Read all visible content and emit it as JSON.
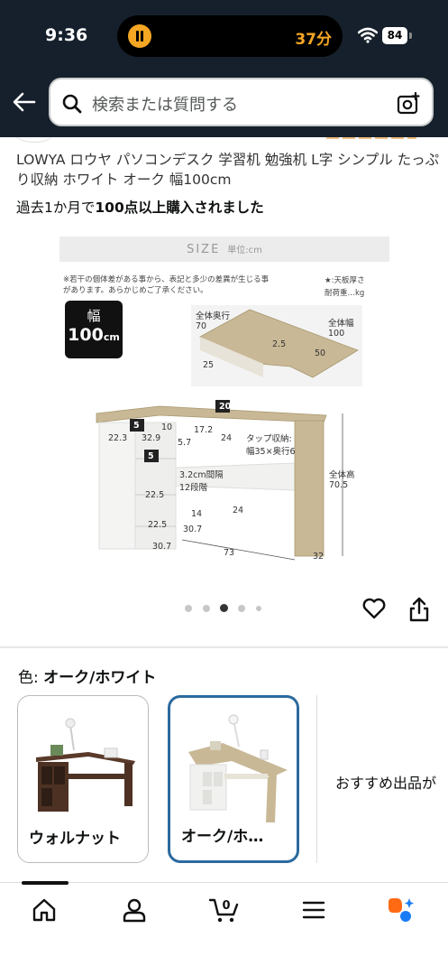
{
  "status_bar": {
    "time": "9:36",
    "timer_text": "37分",
    "battery": "84"
  },
  "header": {
    "search_placeholder": "検索または質問する",
    "icons": [
      "back-arrow-icon",
      "search-icon",
      "camera-icon"
    ]
  },
  "product": {
    "title": "LOWYA ロウヤ パソコンデスク 学習机 勉強机 L字 シンプル たっぷり収納 ホワイト オーク 幅100cm",
    "purchase_prefix": "過去1か月で",
    "purchase_bold": "100点以上購入されました"
  },
  "image": {
    "size_title": "SIZE",
    "size_unit": "単位:cm",
    "note": "※若干の個体差がある事から、表記と多少の差異が生じる事があります。あらかじめご了承ください。",
    "legend_top": "★:天板厚さ",
    "legend_bottom": "耐荷重…kg",
    "badge_line1": "幅",
    "badge_line2": "100",
    "badge_unit": "cm",
    "dims": {
      "depth_all_label": "全体奥行",
      "depth_all": "70",
      "width_all_label": "全体幅",
      "width_all": "100",
      "d25": "25",
      "d50": "50",
      "d25b": "2.5",
      "load20": "20",
      "load5a": "5",
      "load5b": "5",
      "d10": "10",
      "d172": "17.2",
      "d24a": "24",
      "d223": "22.3",
      "d329": "32.9",
      "d57": "5.7",
      "tap_label": "タップ収納:",
      "tap_size": "幅35×奥行6",
      "pitch_label": "3.2cm間隔",
      "pitch_steps": "12段階",
      "d225a": "22.5",
      "d225b": "22.5",
      "d14": "14",
      "d24b": "24",
      "d307a": "30.7",
      "d307b": "30.7",
      "d73": "73",
      "d32": "32",
      "height_label": "全体高",
      "height": "70.5"
    }
  },
  "carousel": {
    "count": 5,
    "active_index": 2
  },
  "color": {
    "label": "色:",
    "selected": "オーク/ホワイト",
    "options": [
      {
        "name": "ウォルナット",
        "selected": false
      },
      {
        "name": "オーク/ホ…",
        "selected": true
      }
    ],
    "recommend": "おすすめ出品が"
  },
  "bottom_nav": {
    "icons": [
      "home-icon",
      "account-icon",
      "cart-icon",
      "menu-icon",
      "rufus-icon"
    ],
    "cart_count": "0"
  },
  "colors": {
    "header_bg": "#16202c",
    "timer_orange": "#f5a623",
    "selected_border": "#2b6a9e",
    "oak": "#c9b896"
  }
}
